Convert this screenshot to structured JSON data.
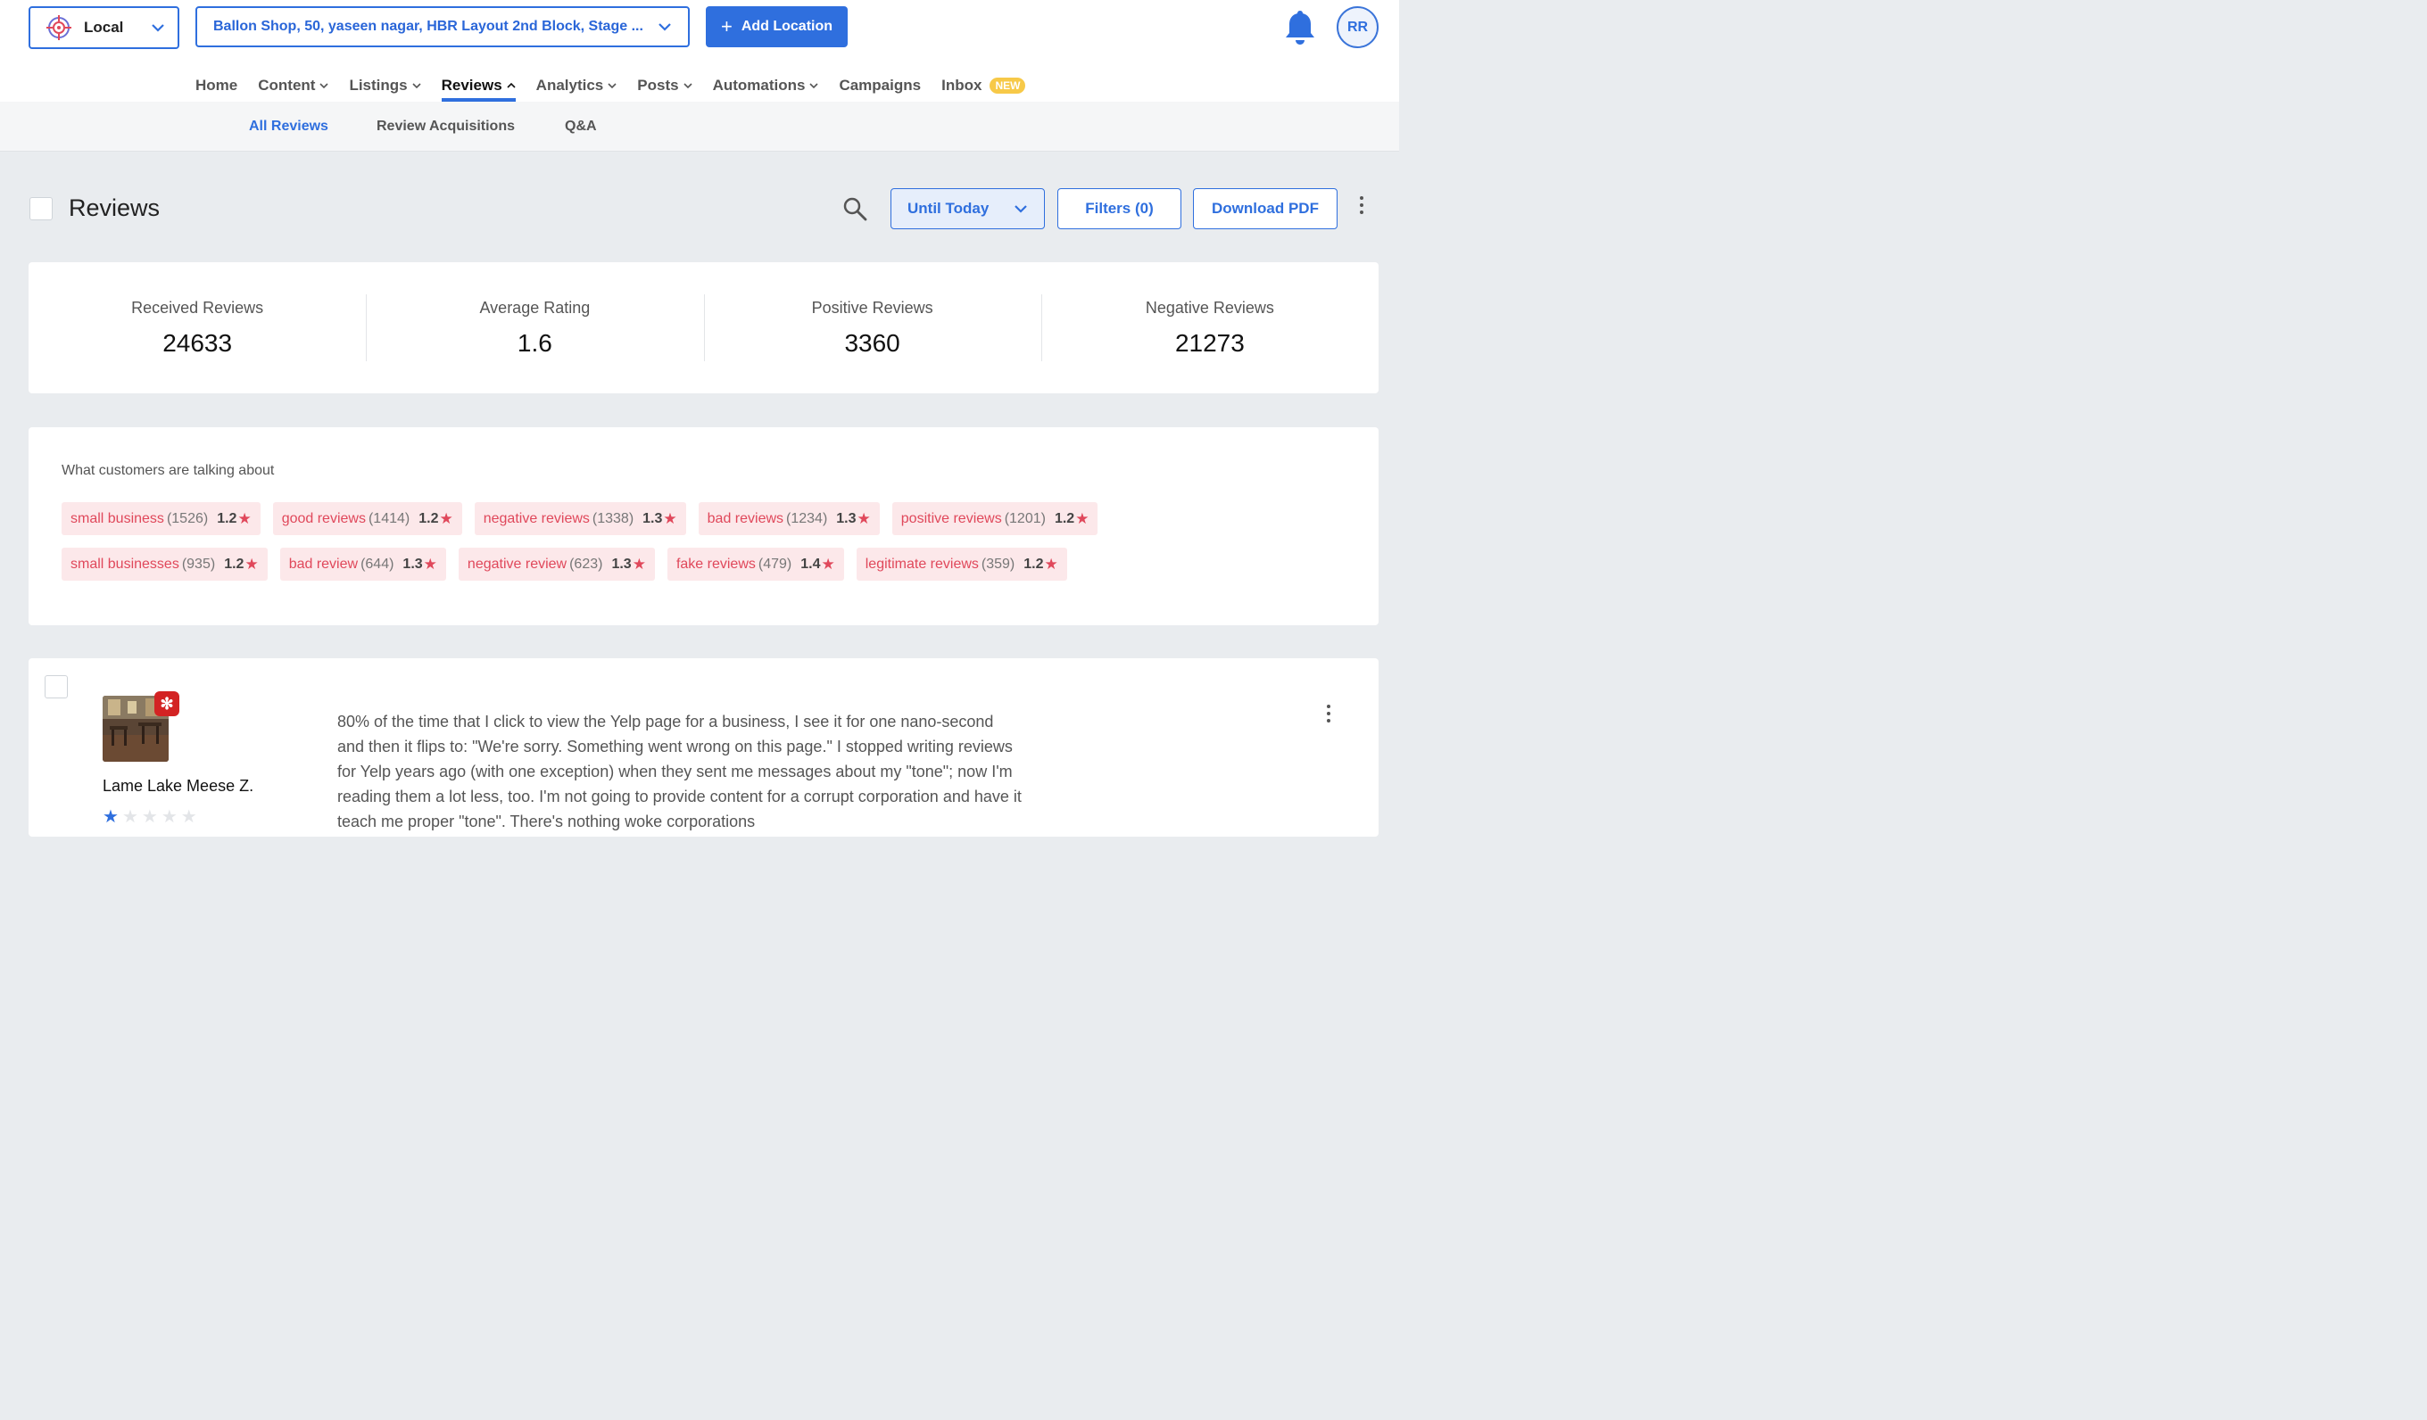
{
  "header": {
    "brand_selector": {
      "label": "Local",
      "icon": "crosshair-logo-icon"
    },
    "location_selector": {
      "label": "Ballon Shop, 50, yaseen nagar, HBR Layout 2nd Block, Stage ..."
    },
    "add_location_label": "Add Location",
    "avatar_initials": "RR"
  },
  "nav": {
    "items": [
      {
        "label": "Home",
        "dropdown": false
      },
      {
        "label": "Content",
        "dropdown": true
      },
      {
        "label": "Listings",
        "dropdown": true
      },
      {
        "label": "Reviews",
        "dropdown": true,
        "active": true
      },
      {
        "label": "Analytics",
        "dropdown": true
      },
      {
        "label": "Posts",
        "dropdown": true
      },
      {
        "label": "Automations",
        "dropdown": true
      },
      {
        "label": "Campaigns",
        "dropdown": false
      },
      {
        "label": "Inbox",
        "dropdown": false,
        "badge": "NEW"
      }
    ]
  },
  "subnav": {
    "items": [
      {
        "label": "All Reviews",
        "active": true
      },
      {
        "label": "Review Acquisitions"
      },
      {
        "label": "Q&A"
      }
    ]
  },
  "toolbar": {
    "title": "Reviews",
    "date_range": "Until Today",
    "filters_label": "Filters (0)",
    "download_label": "Download PDF"
  },
  "stats": [
    {
      "label": "Received Reviews",
      "value": "24633"
    },
    {
      "label": "Average Rating",
      "value": "1.6"
    },
    {
      "label": "Positive Reviews",
      "value": "3360"
    },
    {
      "label": "Negative Reviews",
      "value": "21273"
    }
  ],
  "topics": {
    "title": "What customers are talking about",
    "rows": [
      [
        {
          "term": "small business",
          "count": "(1526)",
          "rating": "1.2"
        },
        {
          "term": "good reviews",
          "count": "(1414)",
          "rating": "1.2"
        },
        {
          "term": "negative reviews",
          "count": "(1338)",
          "rating": "1.3"
        },
        {
          "term": "bad reviews",
          "count": "(1234)",
          "rating": "1.3"
        },
        {
          "term": "positive reviews",
          "count": "(1201)",
          "rating": "1.2"
        }
      ],
      [
        {
          "term": "small businesses",
          "count": "(935)",
          "rating": "1.2"
        },
        {
          "term": "bad review",
          "count": "(644)",
          "rating": "1.3"
        },
        {
          "term": "negative review",
          "count": "(623)",
          "rating": "1.3"
        },
        {
          "term": "fake reviews",
          "count": "(479)",
          "rating": "1.4"
        },
        {
          "term": "legitimate reviews",
          "count": "(359)",
          "rating": "1.2"
        }
      ]
    ]
  },
  "review": {
    "source_icon": "yelp-icon",
    "reviewer": "Lame Lake Meese Z.",
    "stars": 1,
    "max_stars": 5,
    "text": "80% of the time that I click to view the Yelp page for a business, I see it for one nano-second and then it flips to: \"We're sorry. Something went wrong on this page.\" I stopped writing reviews for Yelp years ago (with one exception) when they sent me messages about my \"tone\"; now I'm reading them a lot less, too. I'm not going to provide content for a corrupt corporation and have it teach me proper \"tone\". There's nothing woke corporations"
  },
  "colors": {
    "accent": "#2f6fde",
    "chip_bg": "#fce8ea",
    "chip_text": "#e0485b",
    "badge_new": "#f7c948",
    "yelp_red": "#d32323"
  }
}
